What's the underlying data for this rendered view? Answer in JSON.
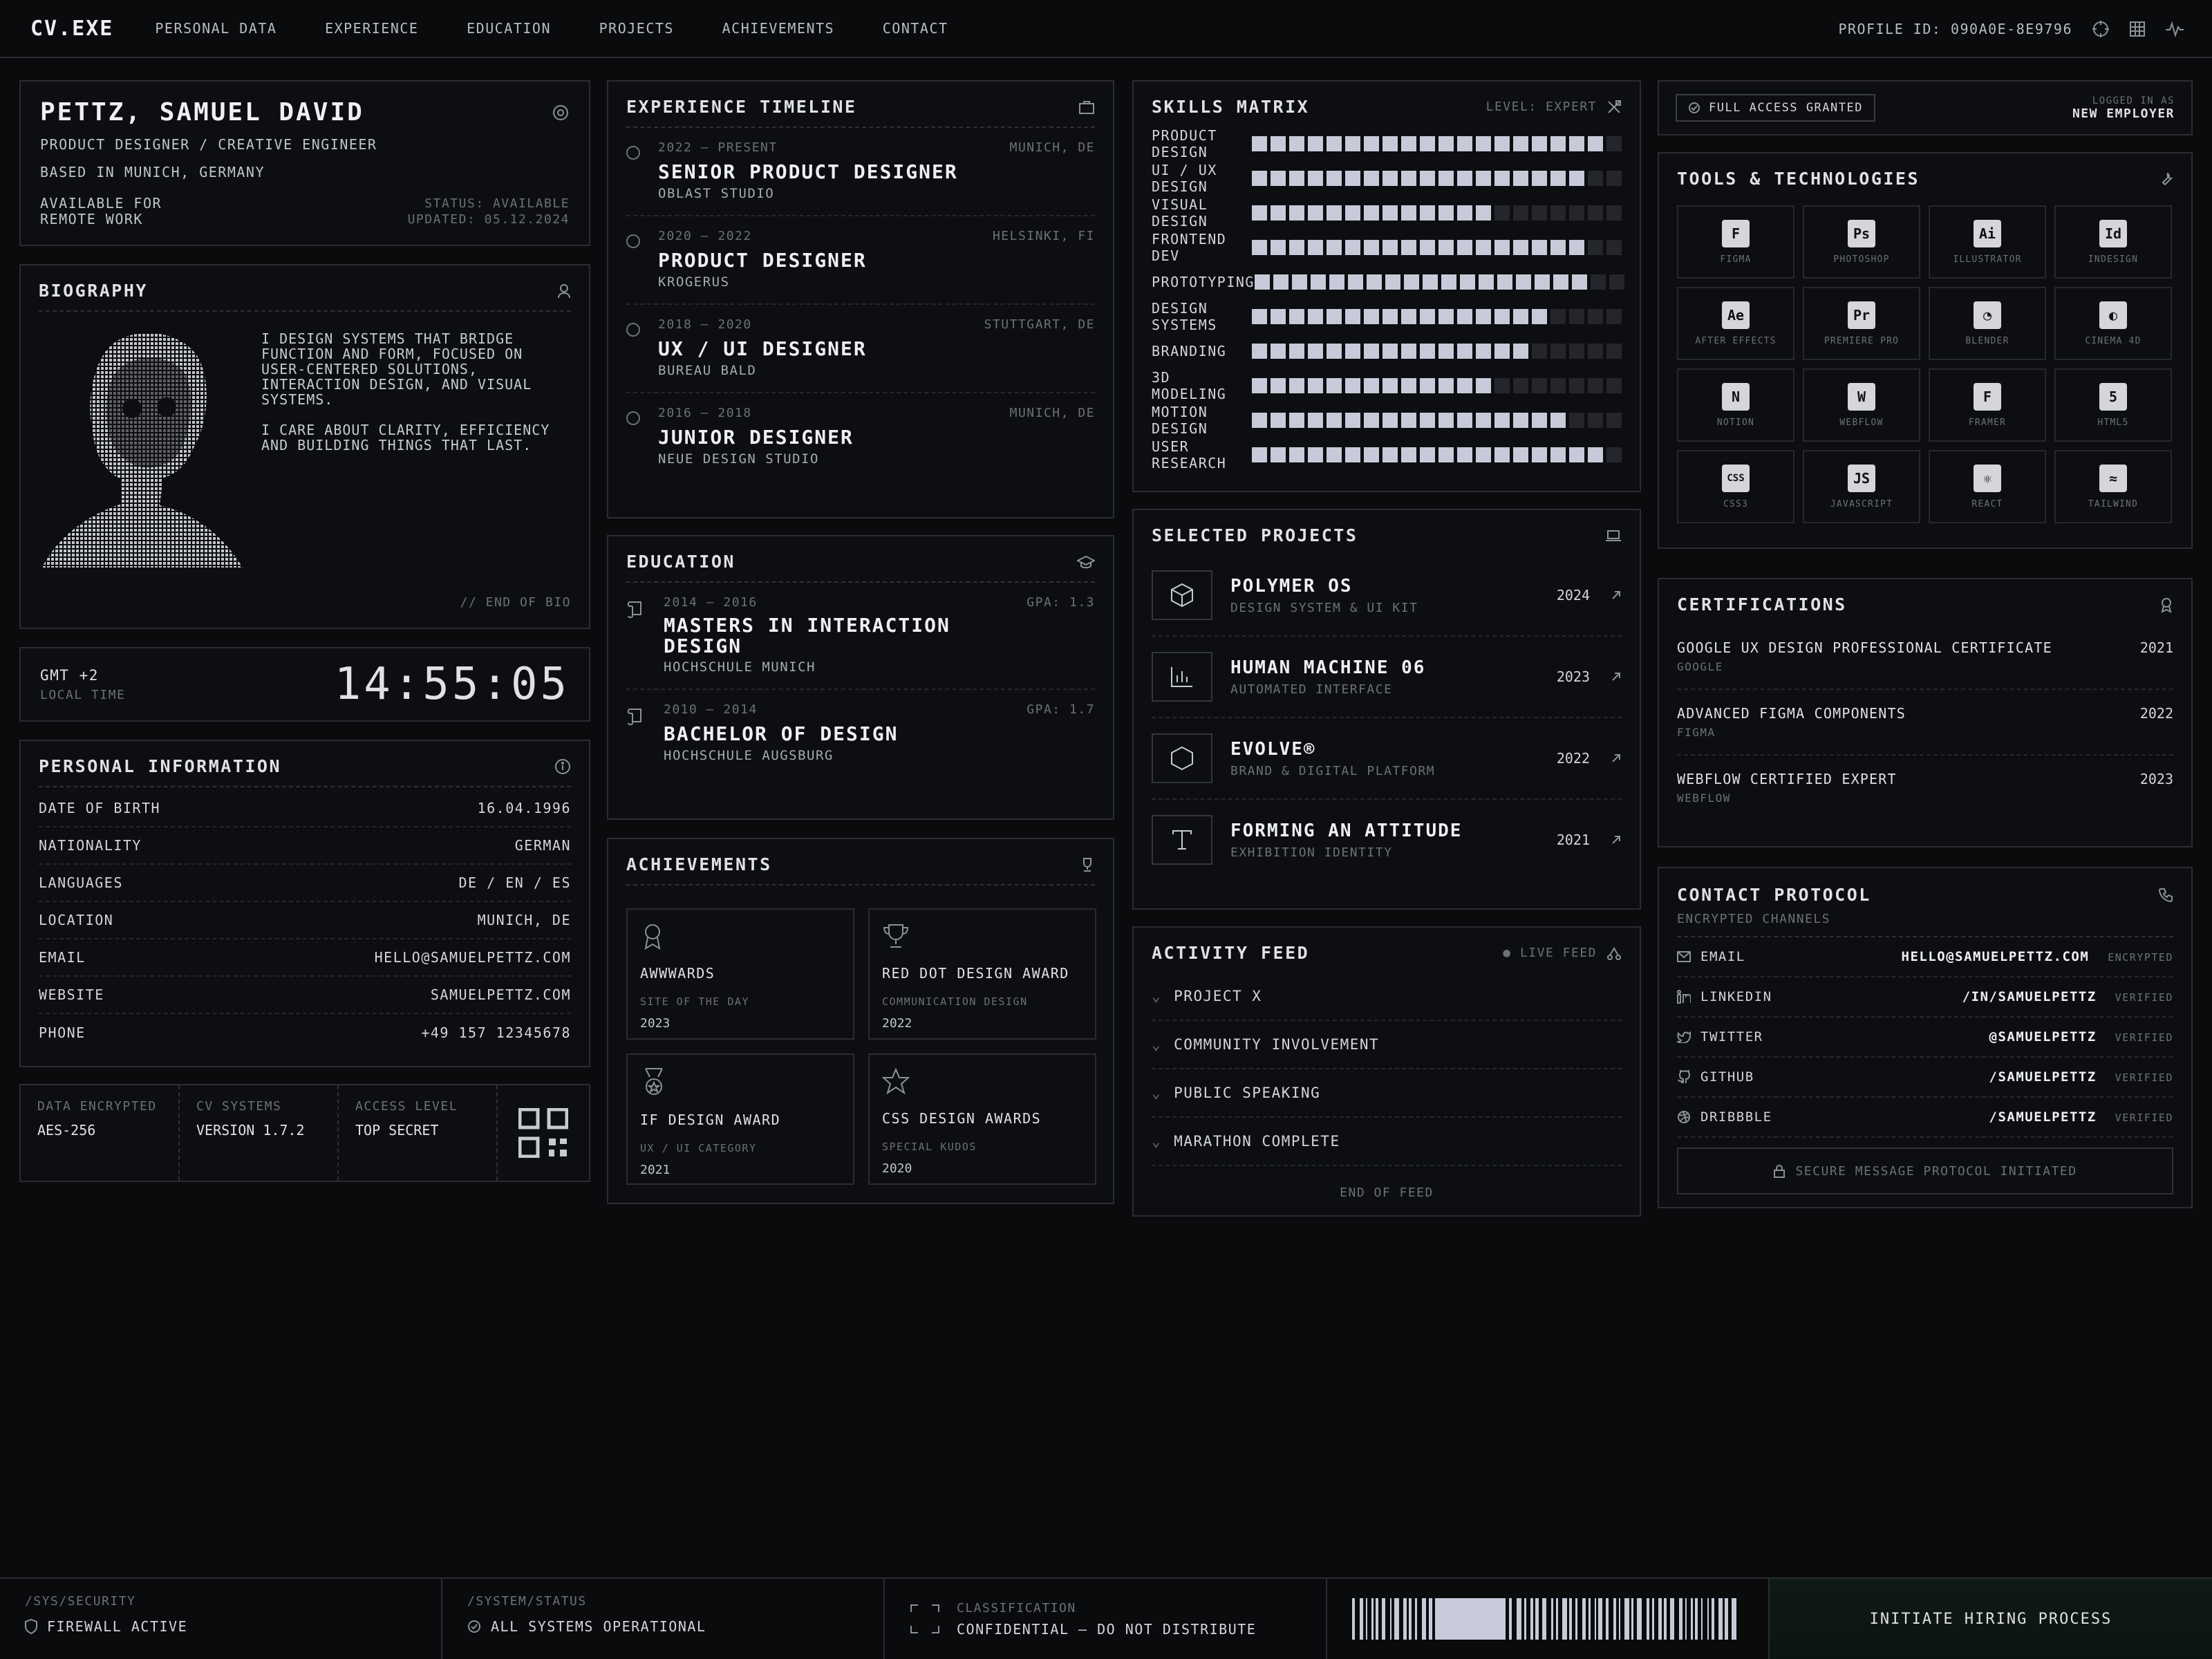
{
  "header": {
    "logo": "CV.EXE",
    "nav": [
      "PERSONAL DATA",
      "EXPERIENCE",
      "EDUCATION",
      "PROJECTS",
      "ACHIEVEMENTS",
      "CONTACT"
    ],
    "profile_id": "PROFILE ID: 090A0E-8E9796"
  },
  "profile": {
    "name": "PETTZ, SAMUEL DAVID",
    "title": "PRODUCT DESIGNER / CREATIVE ENGINEER",
    "based": "BASED IN MUNICH, GERMANY",
    "avail1": "AVAILABLE FOR",
    "avail2": "REMOTE WORK",
    "status": "STATUS: AVAILABLE",
    "updated": "UPDATED: 05.12.2024"
  },
  "bio": {
    "title": "BIOGRAPHY",
    "p1": "I DESIGN SYSTEMS THAT BRIDGE FUNCTION AND FORM, FOCUSED ON USER-CENTERED SOLUTIONS, INTERACTION DESIGN, AND VISUAL SYSTEMS.",
    "p2": "I CARE ABOUT CLARITY, EFFICIENCY AND BUILDING THINGS THAT LAST.",
    "end": "// END OF BIO"
  },
  "clock": {
    "tz": "GMT +2",
    "label": "LOCAL TIME",
    "time": "14:55:05"
  },
  "personal": {
    "title": "PERSONAL INFORMATION",
    "rows": [
      [
        "DATE OF BIRTH",
        "16.04.1996"
      ],
      [
        "NATIONALITY",
        "GERMAN"
      ],
      [
        "LANGUAGES",
        "DE / EN / ES"
      ],
      [
        "LOCATION",
        "MUNICH, DE"
      ],
      [
        "EMAIL",
        "HELLO@SAMUELPETTZ.COM"
      ],
      [
        "WEBSITE",
        "SAMUELPETTZ.COM"
      ],
      [
        "PHONE",
        "+49 157 12345678"
      ]
    ]
  },
  "sys": [
    [
      "DATA ENCRYPTED",
      "AES-256"
    ],
    [
      "CV SYSTEMS",
      "VERSION 1.7.2"
    ],
    [
      "ACCESS LEVEL",
      "TOP SECRET"
    ]
  ],
  "experience": {
    "title": "EXPERIENCE TIMELINE",
    "items": [
      {
        "dates": "2022 — PRESENT",
        "loc": "MUNICH, DE",
        "role": "SENIOR PRODUCT DESIGNER",
        "co": "OBLAST STUDIO"
      },
      {
        "dates": "2020 — 2022",
        "loc": "HELSINKI, FI",
        "role": "PRODUCT DESIGNER",
        "co": "KROGERUS"
      },
      {
        "dates": "2018 — 2020",
        "loc": "STUTTGART, DE",
        "role": "UX / UI DESIGNER",
        "co": "BUREAU BALD"
      },
      {
        "dates": "2016 — 2018",
        "loc": "MUNICH, DE",
        "role": "JUNIOR DESIGNER",
        "co": "NEUE DESIGN STUDIO"
      }
    ]
  },
  "education": {
    "title": "EDUCATION",
    "items": [
      {
        "dates": "2014 — 2016",
        "gpa": "GPA: 1.3",
        "degree": "MASTERS IN INTERACTION DESIGN",
        "school": "HOCHSCHULE MUNICH"
      },
      {
        "dates": "2010 — 2014",
        "gpa": "GPA: 1.7",
        "degree": "BACHELOR OF DESIGN",
        "school": "HOCHSCHULE AUGSBURG"
      }
    ]
  },
  "achievements": {
    "title": "ACHIEVEMENTS",
    "items": [
      {
        "name": "AWWWARDS",
        "sub": "SITE OF THE DAY",
        "year": "2023"
      },
      {
        "name": "RED DOT DESIGN AWARD",
        "sub": "COMMUNICATION DESIGN",
        "year": "2022"
      },
      {
        "name": "IF DESIGN AWARD",
        "sub": "UX / UI CATEGORY",
        "year": "2021"
      },
      {
        "name": "CSS DESIGN AWARDS",
        "sub": "SPECIAL KUDOS",
        "year": "2020"
      }
    ]
  },
  "skills": {
    "title": "SKILLS MATRIX",
    "level": "LEVEL: EXPERT",
    "total": 20,
    "items": [
      {
        "name": "PRODUCT DESIGN",
        "value": 19
      },
      {
        "name": "UI / UX DESIGN",
        "value": 18
      },
      {
        "name": "VISUAL DESIGN",
        "value": 13
      },
      {
        "name": "FRONTEND DEV",
        "value": 18
      },
      {
        "name": "PROTOTYPING",
        "value": 18
      },
      {
        "name": "DESIGN SYSTEMS",
        "value": 16
      },
      {
        "name": "BRANDING",
        "value": 15
      },
      {
        "name": "3D MODELING",
        "value": 13
      },
      {
        "name": "MOTION DESIGN",
        "value": 17
      },
      {
        "name": "USER RESEARCH",
        "value": 19
      }
    ]
  },
  "projects": {
    "title": "SELECTED PROJECTS",
    "items": [
      {
        "name": "POLYMER OS",
        "sub": "DESIGN SYSTEM & UI KIT",
        "year": "2024"
      },
      {
        "name": "HUMAN MACHINE 06",
        "sub": "AUTOMATED INTERFACE",
        "year": "2023"
      },
      {
        "name": "EVOLVE®",
        "sub": "BRAND & DIGITAL PLATFORM",
        "year": "2022"
      },
      {
        "name": "FORMING AN ATTITUDE",
        "sub": "EXHIBITION IDENTITY",
        "year": "2021"
      }
    ]
  },
  "activity": {
    "title": "ACTIVITY FEED",
    "live": "LIVE FEED",
    "items": [
      "PROJECT X",
      "COMMUNITY INVOLVEMENT",
      "PUBLIC SPEAKING",
      "MARATHON COMPLETE"
    ],
    "end": "END OF FEED"
  },
  "access": {
    "badge": "FULL ACCESS GRANTED",
    "l1": "LOGGED IN AS",
    "l2": "NEW EMPLOYER"
  },
  "tools": {
    "title": "TOOLS & TECHNOLOGIES",
    "items": [
      {
        "label": "FIGMA",
        "glyph": "F"
      },
      {
        "label": "PHOTOSHOP",
        "glyph": "Ps"
      },
      {
        "label": "ILLUSTRATOR",
        "glyph": "Ai"
      },
      {
        "label": "INDESIGN",
        "glyph": "Id"
      },
      {
        "label": "AFTER EFFECTS",
        "glyph": "Ae"
      },
      {
        "label": "PREMIERE PRO",
        "glyph": "Pr"
      },
      {
        "label": "BLENDER",
        "glyph": "◔"
      },
      {
        "label": "CINEMA 4D",
        "glyph": "◐"
      },
      {
        "label": "NOTION",
        "glyph": "N"
      },
      {
        "label": "WEBFLOW",
        "glyph": "W"
      },
      {
        "label": "FRAMER",
        "glyph": "F"
      },
      {
        "label": "HTML5",
        "glyph": "5"
      },
      {
        "label": "CSS3",
        "glyph": "CSS"
      },
      {
        "label": "JAVASCRIPT",
        "glyph": "JS"
      },
      {
        "label": "REACT",
        "glyph": "⚛"
      },
      {
        "label": "TAILWIND",
        "glyph": "≈"
      }
    ]
  },
  "certs": {
    "title": "CERTIFICATIONS",
    "items": [
      {
        "name": "GOOGLE UX DESIGN PROFESSIONAL CERTIFICATE",
        "org": "GOOGLE",
        "year": "2021"
      },
      {
        "name": "ADVANCED FIGMA COMPONENTS",
        "org": "FIGMA",
        "year": "2022"
      },
      {
        "name": "WEBFLOW CERTIFIED EXPERT",
        "org": "WEBFLOW",
        "year": "2023"
      }
    ]
  },
  "contact": {
    "title": "CONTACT PROTOCOL",
    "sub": "ENCRYPTED CHANNELS",
    "rows": [
      {
        "label": "EMAIL",
        "value": "HELLO@SAMUELPETTZ.COM",
        "tag": "ENCRYPTED"
      },
      {
        "label": "LINKEDIN",
        "value": "/IN/SAMUELPETTZ",
        "tag": "VERIFIED"
      },
      {
        "label": "TWITTER",
        "value": "@SAMUELPETTZ",
        "tag": "VERIFIED"
      },
      {
        "label": "GITHUB",
        "value": "/SAMUELPETTZ",
        "tag": "VERIFIED"
      },
      {
        "label": "DRIBBBLE",
        "value": "/SAMUELPETTZ",
        "tag": "VERIFIED"
      }
    ],
    "secure": "SECURE MESSAGE PROTOCOL INITIATED"
  },
  "footer": {
    "sec_label": "/SYS/SECURITY",
    "sec": "FIREWALL ACTIVE",
    "stat_label": "/SYSTEM/STATUS",
    "stat": "ALL SYSTEMS OPERATIONAL",
    "class_label": "CLASSIFICATION",
    "class": "CONFIDENTIAL — DO NOT DISTRIBUTE",
    "cta": "INITIATE HIRING PROCESS"
  }
}
